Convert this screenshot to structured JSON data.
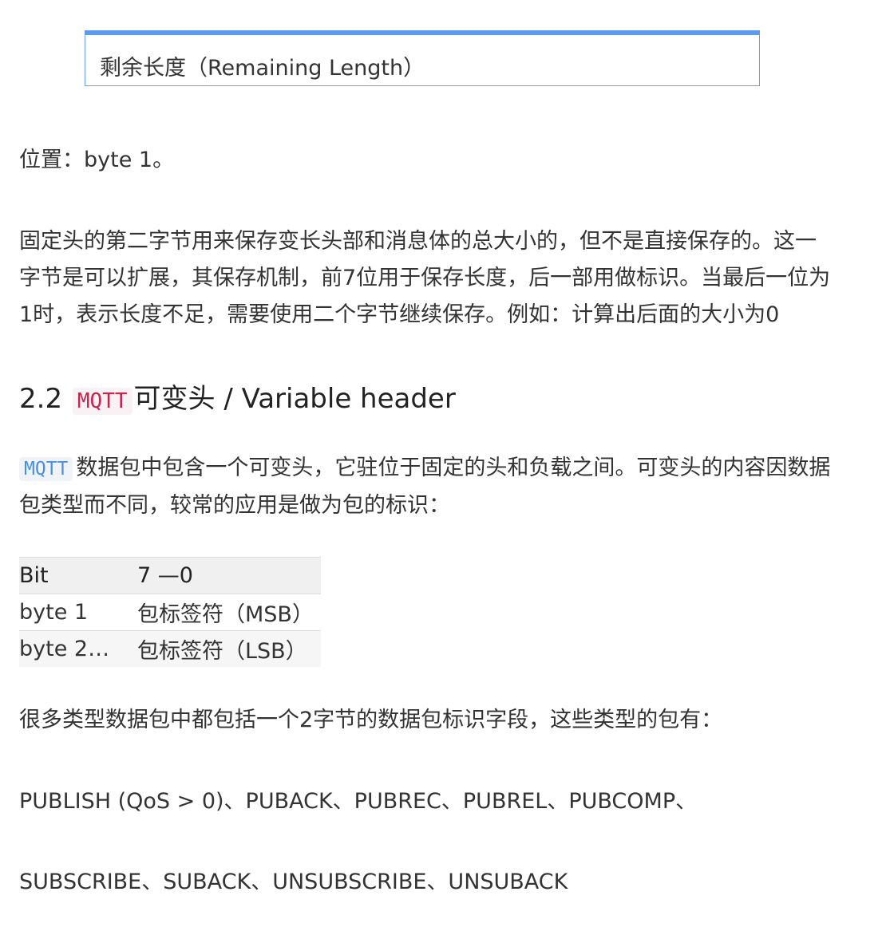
{
  "note_box": {
    "text": "剩余长度（Remaining Length）"
  },
  "position_line": "位置：byte 1。",
  "fixed_header_desc": {
    "lines": [
      "固定头的第二字节用来保存变长头部和消息体的总大小的，但不是直接保存的。这一",
      "字节是可以扩展，其保存机制，前7位用于保存长度，后一部用做标识。当最后一位为",
      "1时，表示长度不足，需要使用二个字节继续保存。例如：计算出后面的大小为0"
    ]
  },
  "section_heading": {
    "number": "2.2",
    "code": "MQTT",
    "text": "可变头 / Variable header"
  },
  "variable_header_desc": {
    "code": "MQTT",
    "line1": "数据包中包含一个可变头，它驻位于固定的头和负载之间。可变头的内容因数据",
    "line2": "包类型而不同，较常的应用是做为包的标识："
  },
  "bit_table": {
    "headers": [
      "Bit",
      "7 —0"
    ],
    "rows": [
      [
        "byte 1",
        "包标签符（MSB）"
      ],
      [
        "byte 2…",
        "包标签符（LSB）"
      ]
    ]
  },
  "packet_types_intro": "很多类型数据包中都包括一个2字节的数据包标识字段，这些类型的包有：",
  "packet_types_line1": "PUBLISH (QoS > 0)、PUBACK、PUBREC、PUBREL、PUBCOMP、",
  "packet_types_line2": "SUBSCRIBE、SUBACK、UNSUBSCRIBE、UNSUBACK"
}
